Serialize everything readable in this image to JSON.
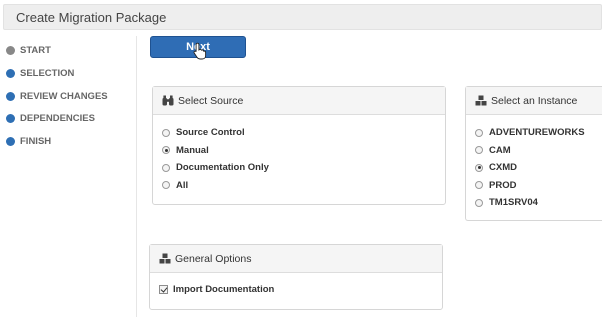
{
  "header": {
    "title": "Create Migration Package"
  },
  "sidebar": {
    "steps": [
      {
        "label": "START",
        "status": "done"
      },
      {
        "label": "SELECTION",
        "status": "pending"
      },
      {
        "label": "REVIEW CHANGES",
        "status": "pending"
      },
      {
        "label": "DEPENDENCIES",
        "status": "pending"
      },
      {
        "label": "FINISH",
        "status": "pending"
      }
    ]
  },
  "toolbar": {
    "next_label": "Next"
  },
  "source_panel": {
    "title": "Select Source",
    "options": [
      {
        "label": "Source Control",
        "selected": false
      },
      {
        "label": "Manual",
        "selected": true
      },
      {
        "label": "Documentation Only",
        "selected": false
      },
      {
        "label": "All",
        "selected": false
      }
    ]
  },
  "instance_panel": {
    "title": "Select an Instance",
    "options": [
      {
        "label": "ADVENTUREWORKS",
        "selected": false
      },
      {
        "label": "CAM",
        "selected": false
      },
      {
        "label": "CXMD",
        "selected": true
      },
      {
        "label": "PROD",
        "selected": false
      },
      {
        "label": "TM1SRV04",
        "selected": false
      }
    ]
  },
  "general_panel": {
    "title": "General Options",
    "options": [
      {
        "label": "Import Documentation",
        "checked": true
      }
    ]
  },
  "colors": {
    "accent": "#2f6db5",
    "step_pending": "#2e6fb4",
    "step_done": "#888888"
  }
}
